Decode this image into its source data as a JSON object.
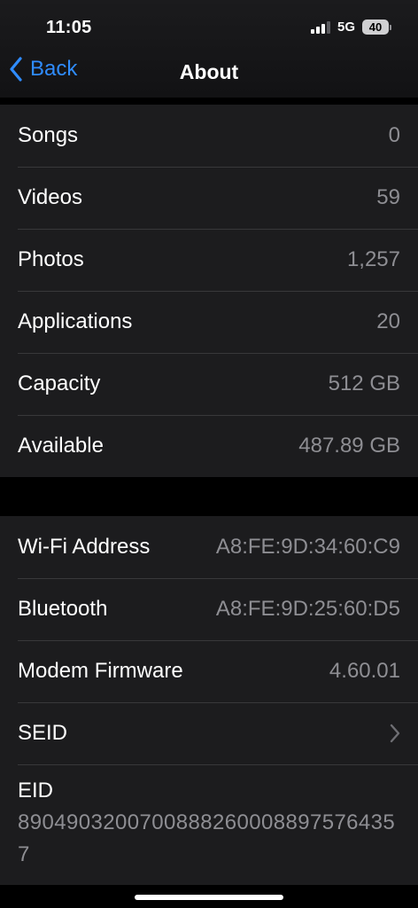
{
  "status_bar": {
    "time": "11:05",
    "network": "5G",
    "battery": "40",
    "signal_bars_active": 3,
    "signal_bars_total": 4
  },
  "nav": {
    "back_label": "Back",
    "title": "About",
    "accent_color": "#2f8cff"
  },
  "media_rows": [
    {
      "label": "Songs",
      "value": "0"
    },
    {
      "label": "Videos",
      "value": "59"
    },
    {
      "label": "Photos",
      "value": "1,257"
    },
    {
      "label": "Applications",
      "value": "20"
    },
    {
      "label": "Capacity",
      "value": "512 GB"
    },
    {
      "label": "Available",
      "value": "487.89 GB"
    }
  ],
  "device_rows": [
    {
      "label": "Wi-Fi Address",
      "value": "A8:FE:9D:34:60:C9"
    },
    {
      "label": "Bluetooth",
      "value": "A8:FE:9D:25:60:D5"
    },
    {
      "label": "Modem Firmware",
      "value": "4.60.01"
    }
  ],
  "seid": {
    "label": "SEID",
    "icon": "chevron-right-icon"
  },
  "eid": {
    "label": "EID",
    "value": "89049032007008882600088975764357"
  }
}
